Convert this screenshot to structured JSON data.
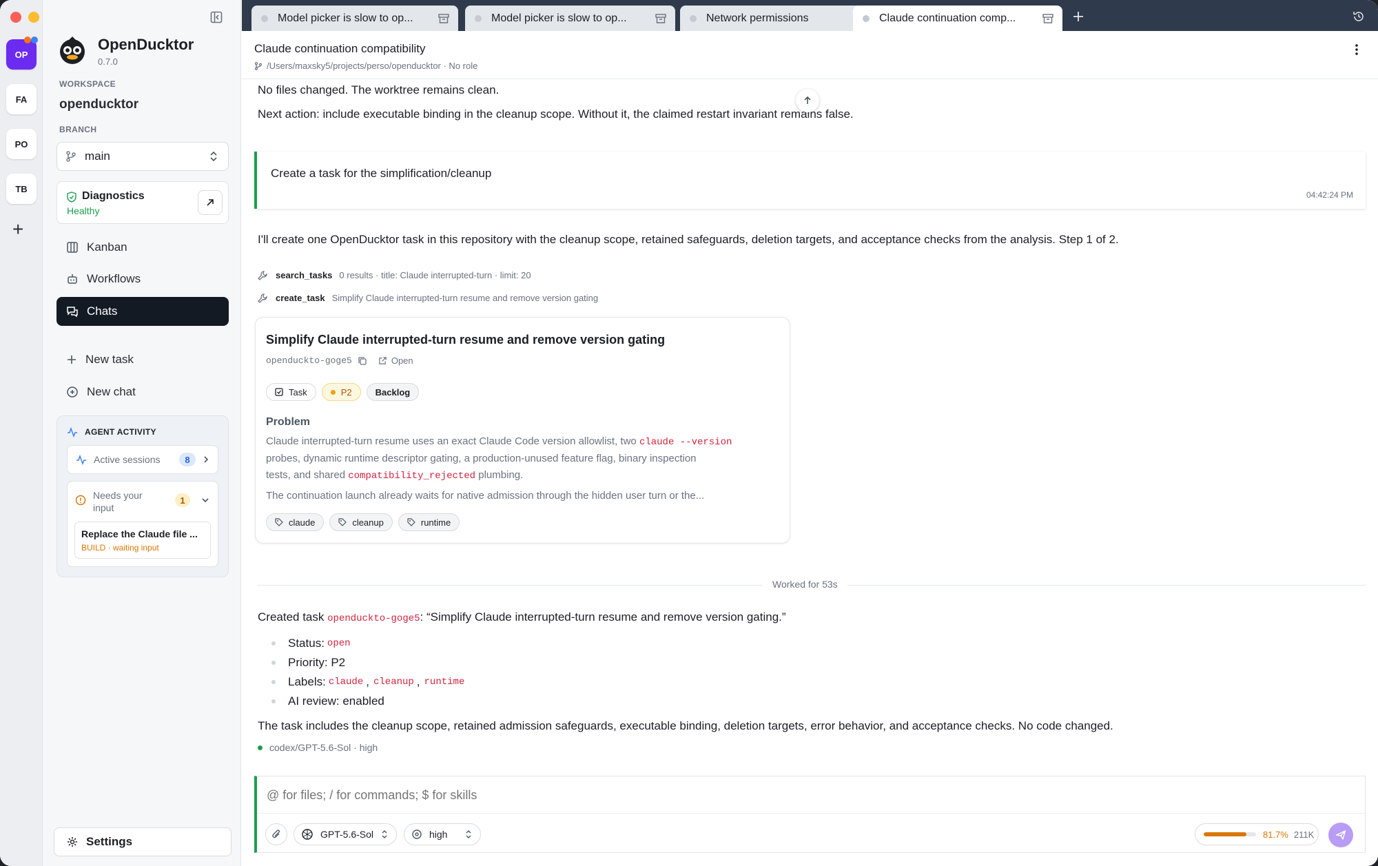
{
  "app": {
    "name": "OpenDucktor",
    "version": "0.7.0"
  },
  "rail": {
    "workspaces": [
      {
        "label": "OP",
        "active": true
      },
      {
        "label": "FA"
      },
      {
        "label": "PO"
      },
      {
        "label": "TB"
      }
    ],
    "add": "+"
  },
  "sidebar": {
    "workspace_label": "WORKSPACE",
    "workspace": "openducktor",
    "branch_label": "BRANCH",
    "branch": "main",
    "diagnostics": {
      "title": "Diagnostics",
      "status": "Healthy"
    },
    "nav": [
      {
        "label": "Kanban",
        "icon": "kanban-icon"
      },
      {
        "label": "Workflows",
        "icon": "workflows-icon"
      },
      {
        "label": "Chats",
        "icon": "chats-icon",
        "active": true
      }
    ],
    "actions": [
      {
        "label": "New task",
        "icon": "plus-icon"
      },
      {
        "label": "New chat",
        "icon": "new-chat-icon"
      }
    ],
    "agent_activity": {
      "title": "AGENT ACTIVITY",
      "active_label": "Active sessions",
      "active_count": "8",
      "needs_label": "Needs your input",
      "needs_count": "1",
      "item_title": "Replace the Claude file ...",
      "item_status": "BUILD · waiting input"
    },
    "settings": "Settings"
  },
  "tabs": [
    {
      "label": "Model picker is slow to op..."
    },
    {
      "label": "Model picker is slow to op..."
    },
    {
      "label": "Network permissions"
    },
    {
      "label": "Claude continuation comp...",
      "active": true
    }
  ],
  "header": {
    "title": "Claude continuation compatibility",
    "path": "/Users/maxsky5/projects/perso/openducktor · No role"
  },
  "chat": {
    "prev_1": "No files changed. The worktree remains clean.",
    "prev_2": "Next action: include executable binding in the cleanup scope. Without it, the claimed restart invariant remains false.",
    "user_msg": "Create a task for the simplification/cleanup",
    "user_time": "04:42:24 PM",
    "assistant_intro": "I'll create one OpenDucktor task in this repository with the cleanup scope, retained safeguards, deletion targets, and acceptance checks from the analysis. Step 1 of 2.",
    "tool1_name": "search_tasks",
    "tool1_detail": "0 results · title: Claude interrupted-turn · limit: 20",
    "tool2_name": "create_task",
    "tool2_detail": "Simplify Claude interrupted-turn resume and remove version gating",
    "card": {
      "title": "Simplify Claude interrupted-turn resume and remove version gating",
      "id": "openduckto-goge5",
      "open": "Open",
      "badges": {
        "type": "Task",
        "priority": "P2",
        "status": "Backlog"
      },
      "problem_label": "Problem",
      "desc_a": "Claude interrupted-turn resume uses an exact Claude Code version allowlist, two ",
      "desc_code1": "claude --version",
      "desc_b": "probes, dynamic runtime descriptor gating, a production-unused feature flag, binary inspection",
      "desc_c": "tests, and shared ",
      "desc_code2": "compatibility_rejected",
      "desc_d": " plumbing.",
      "desc_e": "The continuation launch already waits for native admission through the hidden user turn or the...",
      "tags": [
        "claude",
        "cleanup",
        "runtime"
      ]
    },
    "worked": "Worked for 53s",
    "created_prefix": "Created task ",
    "created_id": "openduckto-goge5",
    "created_suffix": ": “Simplify Claude interrupted-turn resume and remove version gating.”",
    "status_label": "Status: ",
    "status_val": "open",
    "priority_line": "Priority: P2",
    "labels_label": "Labels: ",
    "label1": "claude",
    "label2": "cleanup",
    "label3": "runtime",
    "comma": ",",
    "ai_review": "AI review: enabled",
    "summary": "The task includes the cleanup scope, retained admission safeguards, executable binding, deletion targets, error behavior, and acceptance checks. No code changed.",
    "model_footer": "codex/GPT-5.6-Sol · high"
  },
  "composer": {
    "placeholder": "@ for files; / for commands; $ for skills",
    "model": "GPT-5.6-Sol",
    "effort": "high",
    "context_pct": "81.7%",
    "context_pct_value": 81.7,
    "tokens": "211K"
  },
  "colors": {
    "accent": "#6c2bf0",
    "green": "#1e9e4e",
    "orange": "#d97706",
    "code": "#d1243f",
    "dark": "#141a24"
  }
}
